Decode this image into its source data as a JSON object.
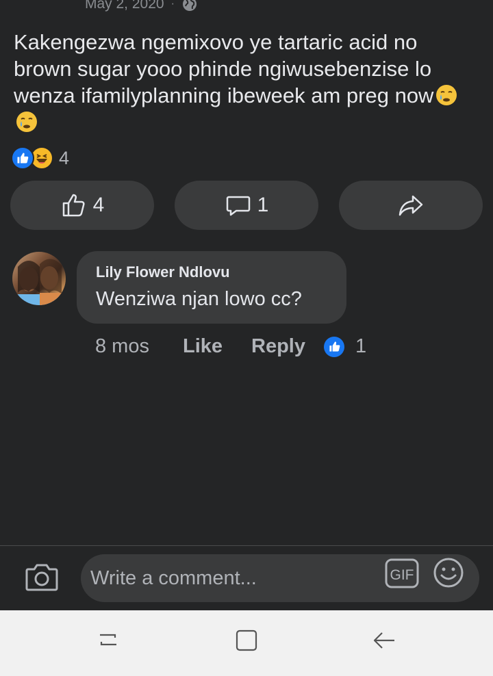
{
  "post": {
    "date": "May 2, 2020",
    "separator": "·",
    "privacy_icon": "globe-icon",
    "text": "Kakengezwa ngemixovo ye tartaric acid no brown sugar yooo phinde ngiwusebenzise lo wenza ifamilyplanning ibeweek am preg now",
    "trailing_emojis": [
      "crying-face-emoji",
      "crying-face-emoji"
    ],
    "reactions": {
      "types": [
        "like",
        "haha"
      ],
      "count": "4"
    }
  },
  "actions": {
    "like_count": "4",
    "comment_count": "1",
    "share_icon": "share-icon"
  },
  "comment": {
    "author": "Lily Flower Ndlovu",
    "text": "Wenziwa  njan lowo cc?",
    "time": "8 mos",
    "like_label": "Like",
    "reply_label": "Reply",
    "reaction_count": "1"
  },
  "composer": {
    "placeholder": "Write a comment...",
    "gif_label": "GIF"
  },
  "colors": {
    "background": "#242526",
    "bubble": "#3a3b3c",
    "accent_blue": "#1877f2",
    "muted_text": "#b0b3b8"
  }
}
